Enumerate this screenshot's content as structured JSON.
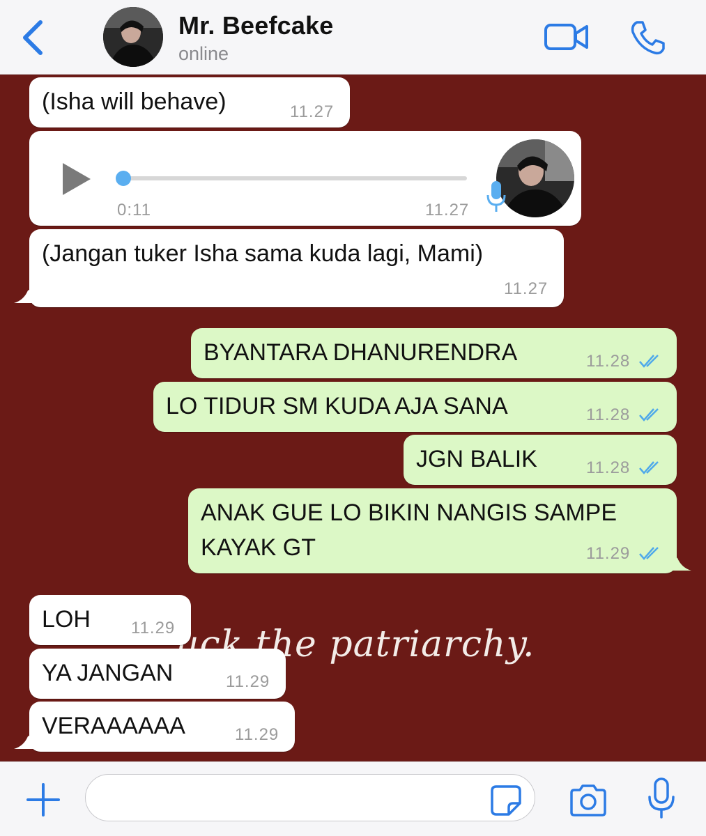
{
  "header": {
    "contact_name": "Mr. Beefcake",
    "status": "online"
  },
  "colors": {
    "accent": "#2c7be5",
    "incoming": "#ffffff",
    "outgoing": "#dcf8c6",
    "wallpaper": "#6b1a16",
    "read_checks": "#4fa9ea"
  },
  "wallpaper_text": "uck the patriarchy.",
  "messages": [
    {
      "text": "(Isha will behave)",
      "time": "11.27"
    },
    {
      "duration": "0:11",
      "time": "11.27",
      "progress": 0
    },
    {
      "text": "(Jangan tuker Isha sama kuda lagi, Mami)",
      "time": "11.27"
    },
    {
      "text": "BYANTARA DHANURENDRA",
      "time": "11.28"
    },
    {
      "text": "LO TIDUR SM KUDA AJA SANA",
      "time": "11.28"
    },
    {
      "text": "JGN BALIK",
      "time": "11.28"
    },
    {
      "line1": "ANAK GUE LO BIKIN NANGIS SAMPE",
      "line2": "KAYAK GT",
      "time": "11.29"
    },
    {
      "text": "LOH",
      "time": "11.29"
    },
    {
      "text": "YA JANGAN",
      "time": "11.29"
    },
    {
      "text": "VERAAAAAA",
      "time": "11.29"
    }
  ],
  "composer": {
    "placeholder": ""
  },
  "icons": [
    "back-chevron-icon",
    "video-call-icon",
    "phone-icon",
    "play-icon",
    "microphone-icon",
    "plus-icon",
    "sticker-icon",
    "camera-icon",
    "read-checks-icon"
  ]
}
